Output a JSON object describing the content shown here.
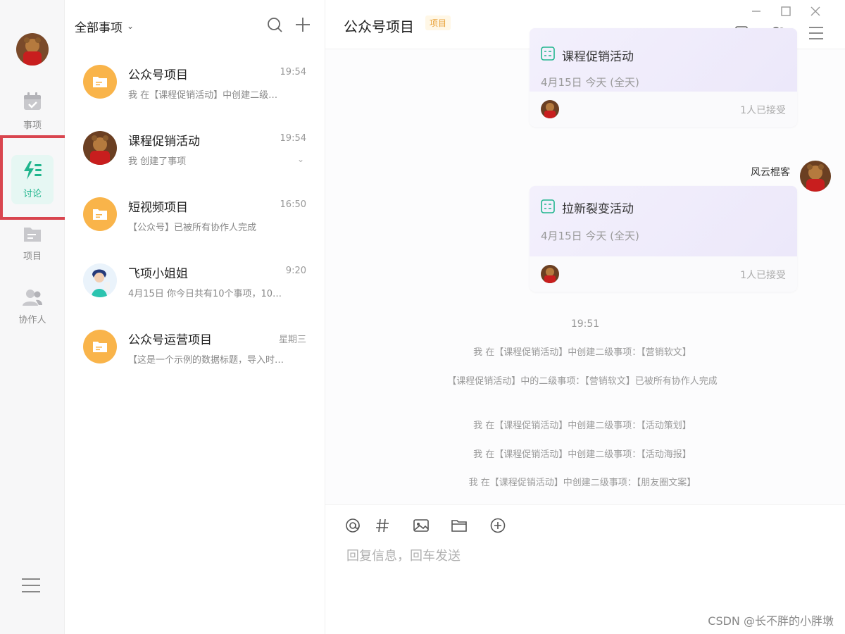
{
  "rail": {
    "items": [
      {
        "label": "事项",
        "icon": "calendar-check-icon"
      },
      {
        "label": "讨论",
        "icon": "lightning-icon"
      },
      {
        "label": "项目",
        "icon": "folder-icon"
      },
      {
        "label": "协作人",
        "icon": "people-icon"
      }
    ]
  },
  "list": {
    "title": "全部事项",
    "conversations": [
      {
        "name": "公众号项目",
        "time": "19:54",
        "preview": "我 在【课程促销活动】中创建二级…",
        "icon": "folder-icon"
      },
      {
        "name": "课程促销活动",
        "time": "19:54",
        "preview": "我 创建了事项",
        "icon": "avatar-bear"
      },
      {
        "name": "短视频项目",
        "time": "16:50",
        "preview": "【公众号】已被所有协作人完成",
        "icon": "folder-icon"
      },
      {
        "name": "飞项小姐姐",
        "time": "9:20",
        "preview": "4月15日 你今日共有10个事项，10…",
        "icon": "avatar-girl"
      },
      {
        "name": "公众号运营项目",
        "time": "星期三",
        "preview": "【这是一个示例的数据标题，导入时…",
        "icon": "folder-icon"
      }
    ]
  },
  "chat": {
    "title": "公众号项目",
    "tag": "项目",
    "cards": [
      {
        "title": "课程促销活动",
        "date": "4月15日 今天 (全天)",
        "accepted": "1人已接受"
      },
      {
        "title": "拉新裂变活动",
        "date": "4月15日 今天 (全天)",
        "accepted": "1人已接受"
      }
    ],
    "sender": "风云棍客",
    "system_time": "19:51",
    "system_messages": [
      "我 在【课程促销活动】中创建二级事项：【营销软文】",
      "【课程促销活动】中的二级事项：【营销软文】已被所有协作人完成",
      "我 在【课程促销活动】中创建二级事项：【活动策划】",
      "我 在【课程促销活动】中创建二级事项：【活动海报】",
      "我 在【课程促销活动】中创建二级事项：【朋友圈文案】"
    ],
    "composer_placeholder": "回复信息，回车发送"
  },
  "watermark": "CSDN @长不胖的小胖墩",
  "colors": {
    "accent": "#1fb58d",
    "folder": "#f9b44a",
    "highlight": "#d9454f",
    "tag": "#e8a23a"
  }
}
